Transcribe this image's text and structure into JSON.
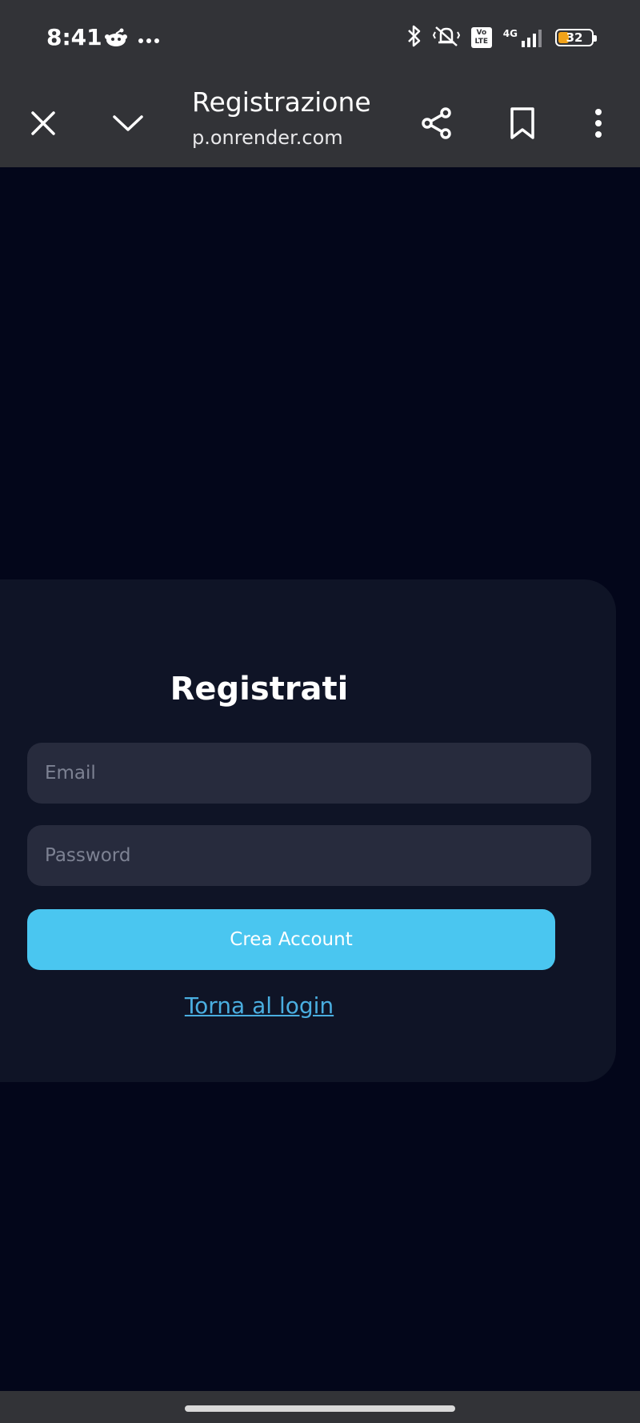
{
  "status_bar": {
    "time": "8:41",
    "battery": {
      "text": "32",
      "level_percent": 32,
      "fill_color": "#f2a31a"
    },
    "icons": [
      "reddit-icon",
      "more-dots-icon",
      "bluetooth-icon",
      "vibrate-muted-icon",
      "volte-icon",
      "4g-icon",
      "signal-icon",
      "battery-icon"
    ],
    "volte": "Vo LTE",
    "network": "4G"
  },
  "browser_toolbar": {
    "title": "Registrazione",
    "url": "p.onrender.com",
    "icons": [
      "close-icon",
      "chevron-down-icon",
      "share-icon",
      "bookmark-icon",
      "kebab-menu-icon"
    ]
  },
  "form": {
    "title": "Registrati",
    "email_placeholder": "Email",
    "password_placeholder": "Password",
    "submit_label": "Crea Account",
    "back_link": "Torna al login"
  },
  "colors": {
    "page_background": "#03061a",
    "card_background": "#0f1426",
    "field_background": "#272b3d",
    "accent": "#4ac6f0",
    "link": "#4aaee0",
    "chrome": "#323337"
  }
}
